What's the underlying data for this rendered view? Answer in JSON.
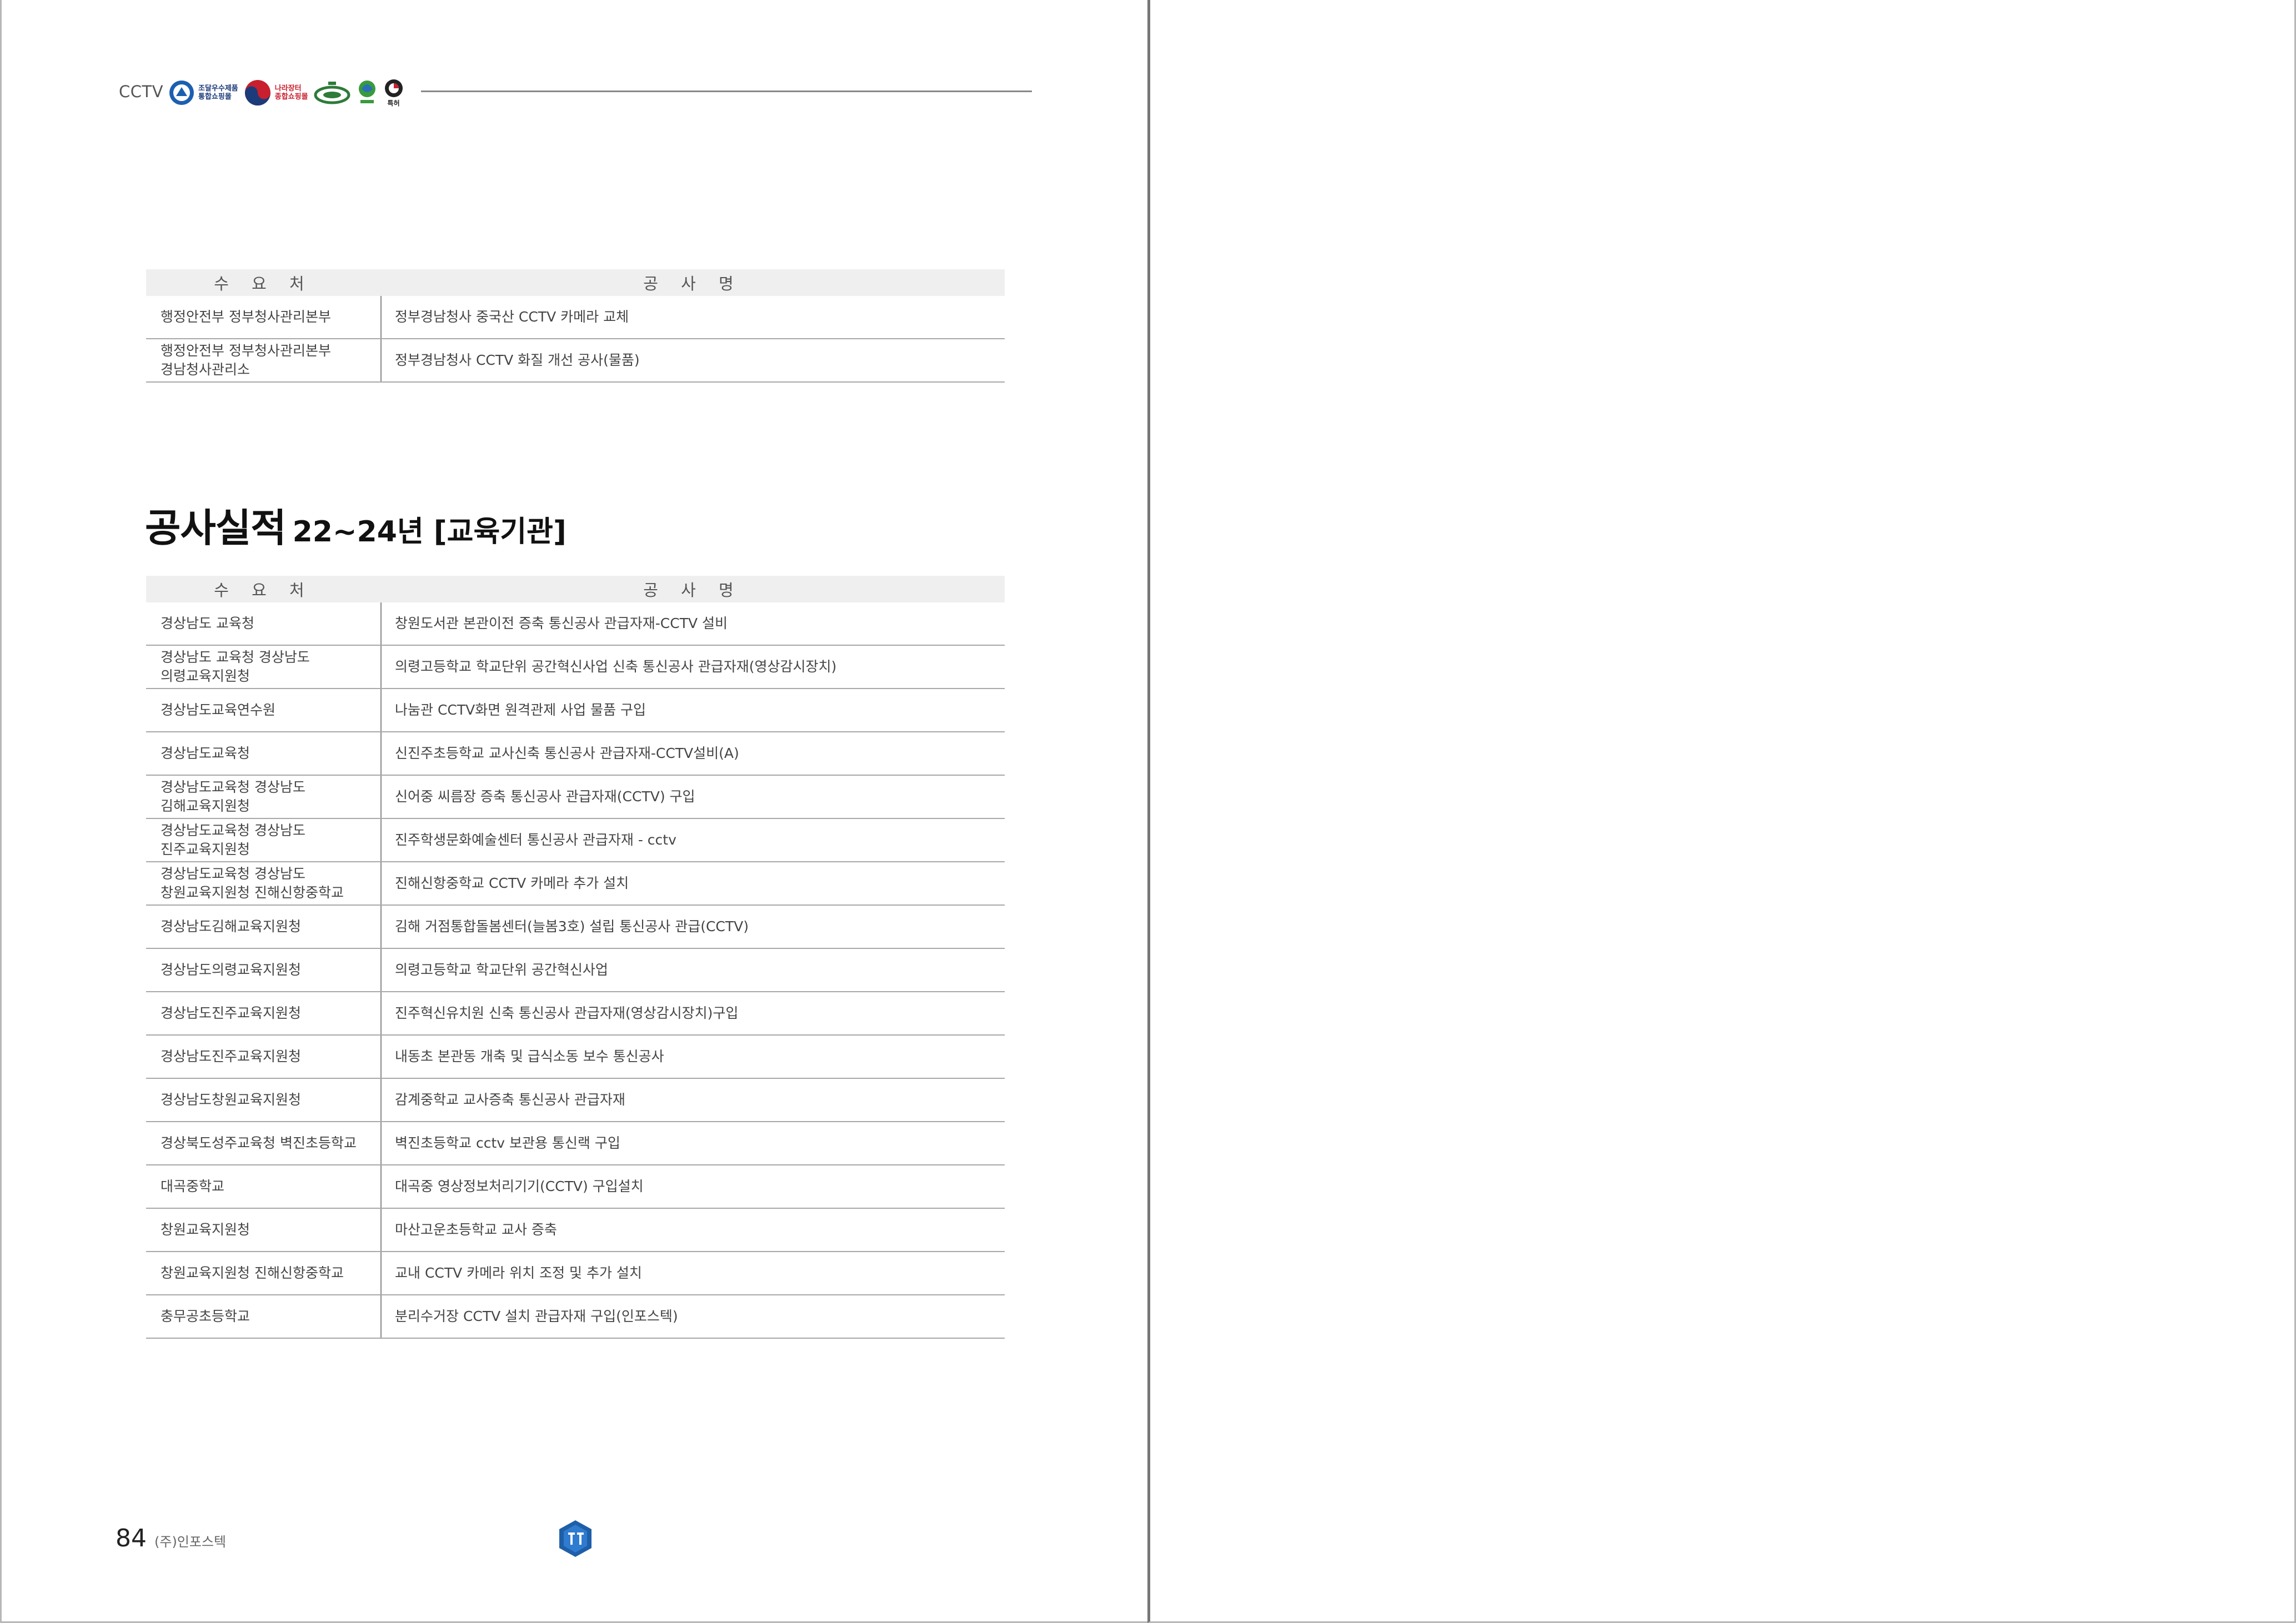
{
  "header": {
    "label": "CCTV",
    "logos": [
      {
        "name": "조달우수제품 통합쇼핑몰",
        "lines": [
          "조달우수제품",
          "통합쇼핑몰"
        ]
      },
      {
        "name": "나라장터 종합쇼핑몰",
        "lines": [
          "나라장터",
          "종합쇼핑몰"
        ]
      }
    ],
    "small_logo_label": "특허"
  },
  "top_table": {
    "headers": [
      "수 요 처",
      "공 사 명"
    ],
    "rows": [
      {
        "client": "행정안전부 정부청사관리본부",
        "project": "정부경남청사 중국산 CCTV 카메라 교체"
      },
      {
        "client": "행정안전부 정부청사관리본부\n경남청사관리소",
        "project": "정부경남청사 CCTV 화질 개선 공사(물품)"
      }
    ]
  },
  "section": {
    "title": "공사실적",
    "subtitle": "22~24년 [교육기관]"
  },
  "edu_table": {
    "headers": [
      "수 요 처",
      "공 사 명"
    ],
    "rows": [
      {
        "client": "경상남도 교육청",
        "project": "창원도서관 본관이전 증축 통신공사 관급자재-CCTV 설비"
      },
      {
        "client": "경상남도 교육청 경상남도\n의령교육지원청",
        "project": "의령고등학교 학교단위 공간혁신사업 신축 통신공사 관급자재(영상감시장치)"
      },
      {
        "client": "경상남도교육연수원",
        "project": "나눔관 CCTV화면 원격관제 사업 물품 구입"
      },
      {
        "client": "경상남도교육청",
        "project": "신진주초등학교 교사신축 통신공사 관급자재-CCTV설비(A)"
      },
      {
        "client": "경상남도교육청 경상남도\n김해교육지원청",
        "project": "신어중 씨름장 증축 통신공사 관급자재(CCTV) 구입"
      },
      {
        "client": "경상남도교육청 경상남도\n진주교육지원청",
        "project": "진주학생문화예술센터 통신공사 관급자재 - cctv"
      },
      {
        "client": "경상남도교육청 경상남도\n창원교육지원청 진해신항중학교",
        "project": "진해신항중학교  CCTV 카메라 추가 설치"
      },
      {
        "client": "경상남도김해교육지원청",
        "project": "김해 거점통합돌봄센터(늘봄3호) 설립 통신공사 관급(CCTV)"
      },
      {
        "client": "경상남도의령교육지원청",
        "project": "의령고등학교 학교단위 공간혁신사업"
      },
      {
        "client": "경상남도진주교육지원청",
        "project": "진주혁신유치원 신축 통신공사 관급자재(영상감시장치)구입"
      },
      {
        "client": "경상남도진주교육지원청",
        "project": "내동초 본관동 개축 및 급식소동 보수 통신공사"
      },
      {
        "client": "경상남도창원교육지원청",
        "project": "감계중학교 교사증축 통신공사 관급자재"
      },
      {
        "client": "경상북도성주교육청 벽진초등학교",
        "project": "벽진초등학교 cctv 보관용 통신랙 구입"
      },
      {
        "client": "대곡중학교",
        "project": "대곡중 영상정보처리기기(CCTV) 구입설치"
      },
      {
        "client": "창원교육지원청",
        "project": "마산고운초등학교 교사 증축"
      },
      {
        "client": "창원교육지원청 진해신항중학교",
        "project": "교내 CCTV 카메라 위치 조정 및 추가 설치"
      },
      {
        "client": "충무공초등학교",
        "project": "분리수거장 CCTV 설치 관급자재 구입(인포스텍)"
      }
    ]
  },
  "footer": {
    "page_number": "84",
    "company": "(주)인포스텍",
    "logo_icon": "company-emblem-icon",
    "emblem_color": "#1f5fa8"
  }
}
